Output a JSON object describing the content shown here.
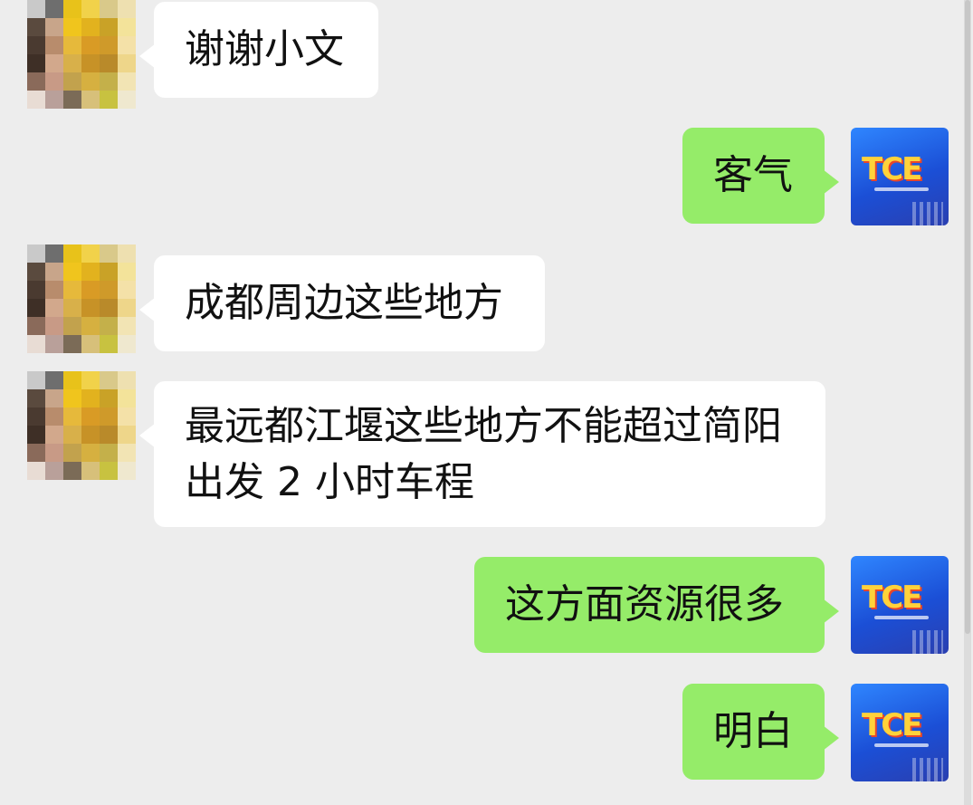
{
  "messages": [
    {
      "side": "left",
      "text": "谢谢小文"
    },
    {
      "side": "right",
      "text": "客气"
    },
    {
      "side": "left",
      "text": "成都周边这些地方"
    },
    {
      "side": "left",
      "text": "最远都江堰这些地方不能超过简阳\n出发 2 小时车程"
    },
    {
      "side": "right",
      "text": "这方面资源很多"
    },
    {
      "side": "right",
      "text": "明白"
    }
  ],
  "colors": {
    "background": "#ededed",
    "incoming_bubble": "#ffffff",
    "outgoing_bubble": "#95ec69"
  },
  "icons": {
    "contact_avatar": "pixelated-avatar-icon",
    "self_avatar": "tce-logo-avatar-icon"
  }
}
